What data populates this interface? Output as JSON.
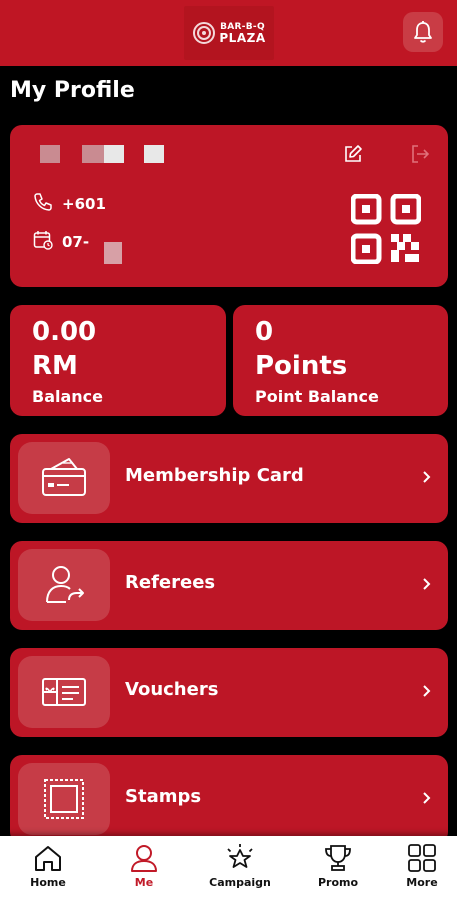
{
  "header": {
    "logo_line1": "BAR-B-Q",
    "logo_line2": "PLAZA",
    "bell_icon": "bell-icon"
  },
  "page_title": "My Profile",
  "profile": {
    "phone": "+601",
    "dob": "07-",
    "qr_icon": "qr-code-icon",
    "edit_icon": "edit-icon",
    "logout_icon": "logout-icon"
  },
  "balance": {
    "value": "0.00",
    "unit": "RM",
    "label": "Balance"
  },
  "points": {
    "value": "0",
    "unit": "Points",
    "label": "Point Balance"
  },
  "menu": [
    {
      "label": "Membership Card",
      "icon": "membership-card-icon"
    },
    {
      "label": "Referees",
      "icon": "referees-icon"
    },
    {
      "label": "Vouchers",
      "icon": "voucher-icon"
    },
    {
      "label": "Stamps",
      "icon": "stamp-icon"
    }
  ],
  "nav": [
    {
      "label": "Home",
      "icon": "home-icon"
    },
    {
      "label": "Me",
      "icon": "user-icon",
      "active": true
    },
    {
      "label": "Campaign",
      "icon": "campaign-icon"
    },
    {
      "label": "Promo",
      "icon": "trophy-icon"
    },
    {
      "label": "More",
      "icon": "grid-icon"
    }
  ],
  "colors": {
    "brand": "#bd1626",
    "active_nav": "#c11a28",
    "background": "#000000"
  }
}
